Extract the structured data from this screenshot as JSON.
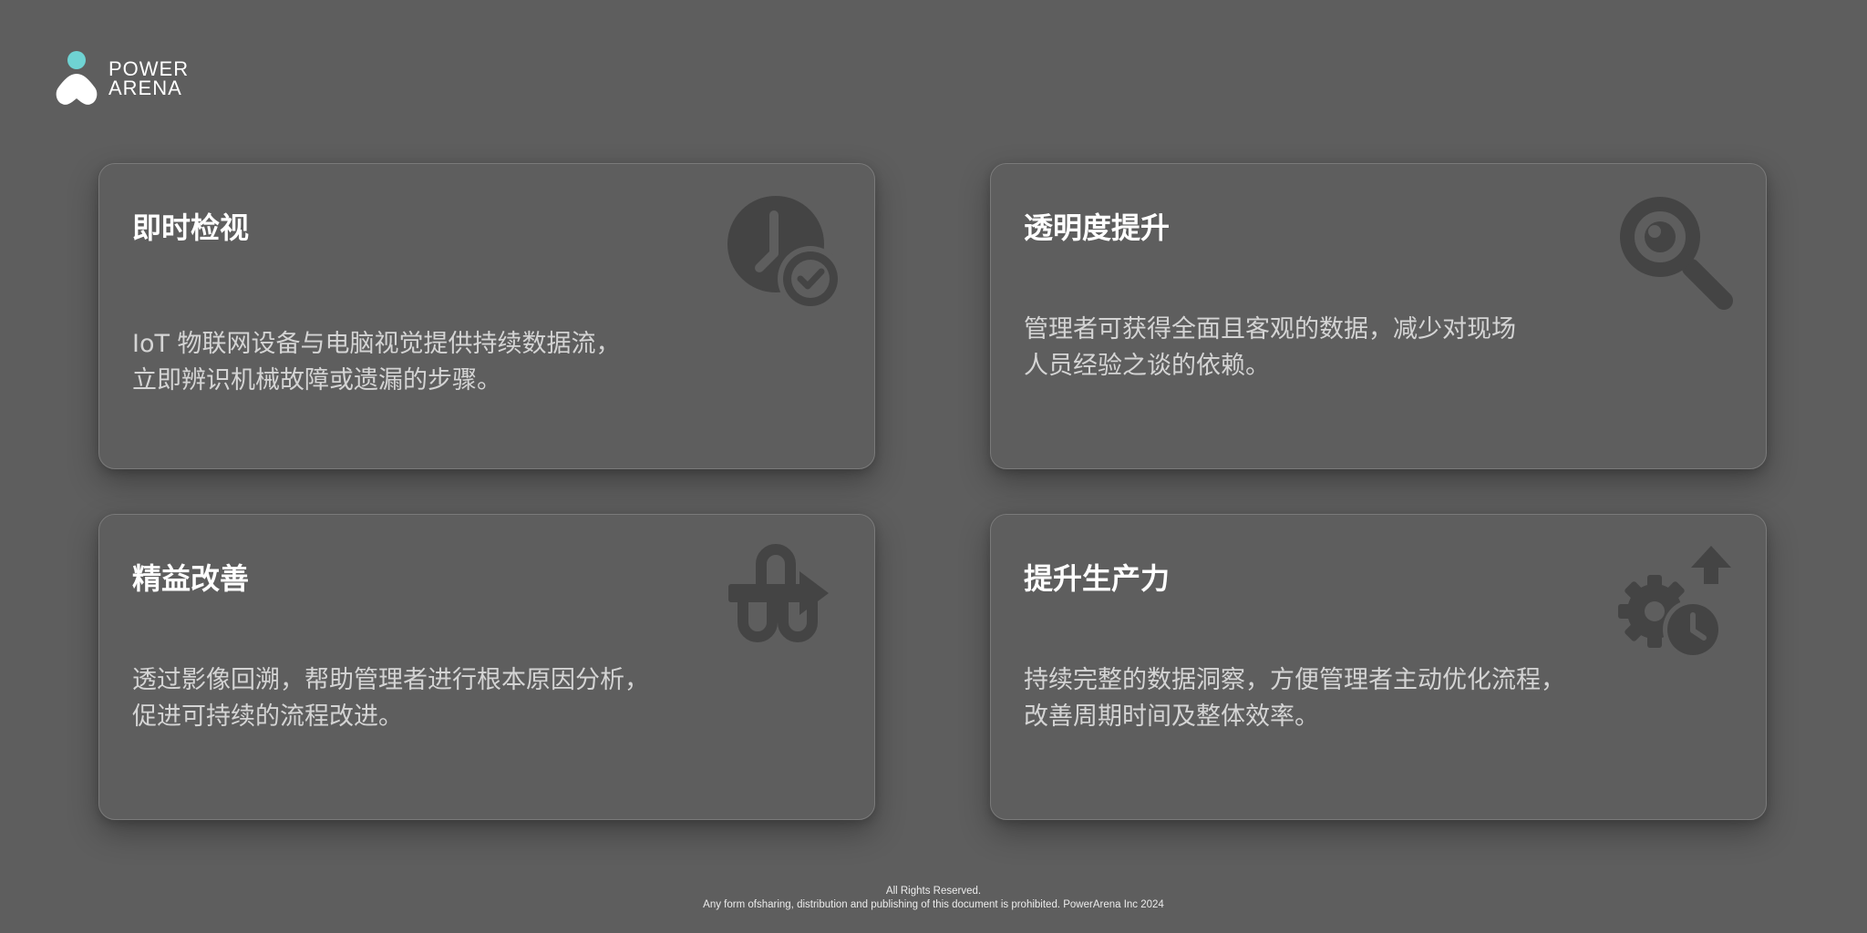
{
  "brand": {
    "line1": "POWER",
    "line2": "ARENA",
    "dot_color": "#6fd3d3",
    "logo_icon": "person-logo-icon"
  },
  "cards": [
    {
      "title": "即时检视",
      "desc_line1": "IoT 物联网设备与电脑视觉提供持续数据流，",
      "desc_line2": "立即辨识机械故障或遗漏的步骤。",
      "icon": "clock-check-icon"
    },
    {
      "title": "透明度提升",
      "desc_line1": "管理者可获得全面且客观的数据，减少对现场",
      "desc_line2": "人员经验之谈的依赖。",
      "icon": "magnifier-icon"
    },
    {
      "title": "精益改善",
      "desc_line1": "透过影像回溯，帮助管理者进行根本原因分析，",
      "desc_line2": "促进可持续的流程改进。",
      "icon": "process-loop-arrow-icon"
    },
    {
      "title": "提升生产力",
      "desc_line1": "持续完整的数据洞察，方便管理者主动优化流程，",
      "desc_line2": "改善周期时间及整体效率。",
      "icon": "gear-clock-arrow-up-icon"
    }
  ],
  "footer": {
    "line1": "All Rights Reserved.",
    "line2": "Any form ofsharing, distribution and publishing of this document is prohibited. PowerArena Inc 2024"
  },
  "colors": {
    "background": "#5e5e5e",
    "card_border": "#7a7a7a",
    "icon": "#444444",
    "title": "#ffffff",
    "text": "#d4d4d4"
  }
}
